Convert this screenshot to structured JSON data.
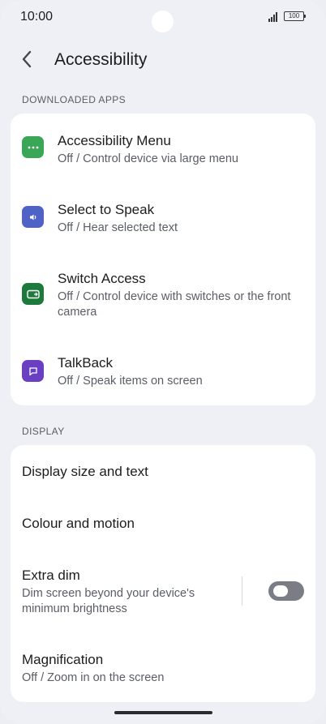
{
  "status_bar": {
    "time": "10:00",
    "battery": "100"
  },
  "header": {
    "title": "Accessibility",
    "back_icon": "chevron-left-icon"
  },
  "downloaded_apps": {
    "section_label": "DOWNLOADED APPS",
    "items": [
      {
        "title": "Accessibility Menu",
        "subtitle": "Off / Control device via large menu",
        "icon": "more-dots-icon",
        "icon_color": "#3aa757"
      },
      {
        "title": "Select to Speak",
        "subtitle": "Off / Hear selected text",
        "icon": "speaker-icon",
        "icon_color": "#4f63c6"
      },
      {
        "title": "Switch Access",
        "subtitle": "Off / Control device with switches or the front camera",
        "icon": "switch-access-icon",
        "icon_color": "#1e7a3c"
      },
      {
        "title": "TalkBack",
        "subtitle": "Off / Speak items on screen",
        "icon": "chat-bubble-icon",
        "icon_color": "#6a3fc1"
      }
    ]
  },
  "display": {
    "section_label": "DISPLAY",
    "items": [
      {
        "title": "Display size and text"
      },
      {
        "title": "Colour and motion"
      },
      {
        "title": "Extra dim",
        "subtitle": "Dim screen beyond your device's minimum brightness",
        "toggle_on": false
      },
      {
        "title": "Magnification",
        "subtitle": "Off / Zoom in on the screen"
      }
    ]
  }
}
